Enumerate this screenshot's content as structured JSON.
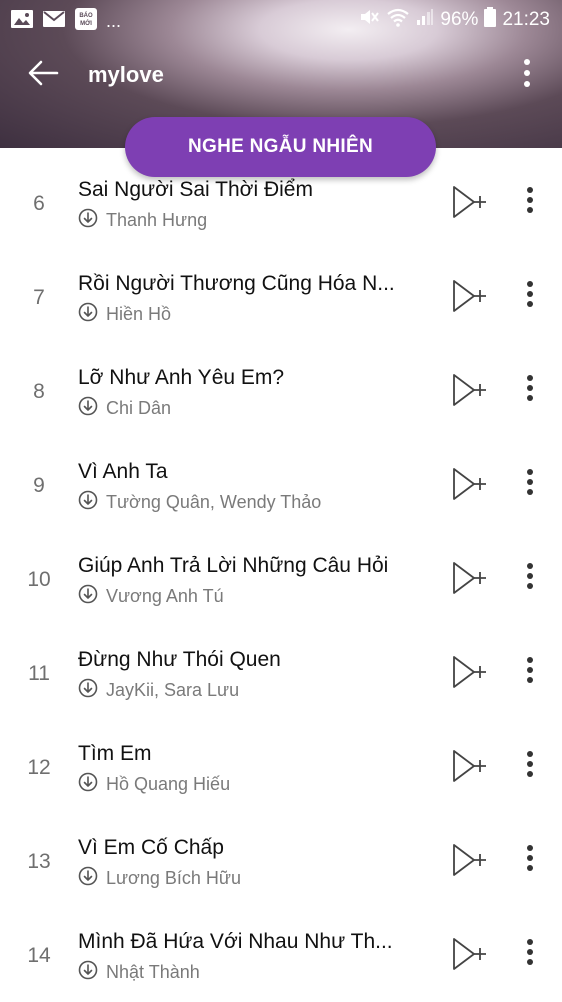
{
  "status_bar": {
    "left_icons": [
      "image-icon",
      "mail-icon",
      "baomoi-icon"
    ],
    "baomoi_text": "BÁO MỚI",
    "overflow": "...",
    "battery": "96%",
    "time": "21:23"
  },
  "header": {
    "title": "mylove",
    "back_icon": "arrow-left-icon",
    "menu_icon": "more-vertical-icon"
  },
  "shuffle_button": {
    "label": "NGHE NGẪU NHIÊN",
    "color": "#7e3fb3"
  },
  "songs": [
    {
      "number": "6",
      "title": "Sai Người Sai Thời Điểm",
      "artist": "Thanh Hưng"
    },
    {
      "number": "7",
      "title": "Rồi Người Thương Cũng Hóa N...",
      "artist": "Hiền Hồ"
    },
    {
      "number": "8",
      "title": "Lỡ Như Anh Yêu Em?",
      "artist": "Chi Dân"
    },
    {
      "number": "9",
      "title": "Vì Anh Ta",
      "artist": "Tường Quân, Wendy Thảo"
    },
    {
      "number": "10",
      "title": "Giúp Anh Trả Lời Những Câu Hỏi",
      "artist": "Vương Anh Tú"
    },
    {
      "number": "11",
      "title": "Đừng Như Thói Quen",
      "artist": "JayKii, Sara Lưu"
    },
    {
      "number": "12",
      "title": "Tìm Em",
      "artist": "Hồ Quang Hiếu"
    },
    {
      "number": "13",
      "title": "Vì Em Cố Chấp",
      "artist": "Lương Bích Hữu"
    },
    {
      "number": "14",
      "title": "Mình Đã Hứa Với Nhau Như Th...",
      "artist": "Nhật Thành"
    }
  ]
}
